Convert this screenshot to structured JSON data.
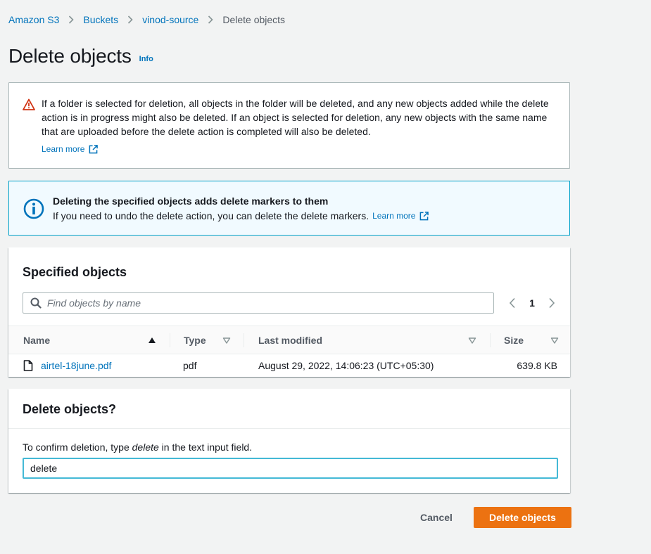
{
  "breadcrumb": {
    "items": [
      "Amazon S3",
      "Buckets",
      "vinod-source"
    ],
    "current": "Delete objects"
  },
  "page": {
    "title": "Delete objects",
    "info_link": "Info"
  },
  "warning": {
    "text": "If a folder is selected for deletion, all objects in the folder will be deleted, and any new objects added while the delete action is in progress might also be deleted. If an object is selected for deletion, any new objects with the same name that are uploaded before the delete action is completed will also be deleted.",
    "learn_more": "Learn more"
  },
  "info": {
    "title": "Deleting the specified objects adds delete markers to them",
    "body": "If you need to undo the delete action, you can delete the delete markers.",
    "learn_more": "Learn more"
  },
  "objects": {
    "title": "Specified objects",
    "search_placeholder": "Find objects by name",
    "page_number": "1",
    "columns": [
      "Name",
      "Type",
      "Last modified",
      "Size"
    ],
    "rows": [
      {
        "name": "airtel-18june.pdf",
        "type": "pdf",
        "last_modified": "August 29, 2022, 14:06:23 (UTC+05:30)",
        "size": "639.8 KB"
      }
    ]
  },
  "confirm": {
    "title": "Delete objects?",
    "label_prefix": "To confirm deletion, type ",
    "label_keyword": "delete",
    "label_suffix": " in the text input field.",
    "input_value": "delete"
  },
  "actions": {
    "cancel": "Cancel",
    "delete": "Delete objects"
  },
  "colors": {
    "link": "#0073bb",
    "primary_button": "#ec7211",
    "info_border": "#00a1c9",
    "warning_icon": "#d13212"
  }
}
